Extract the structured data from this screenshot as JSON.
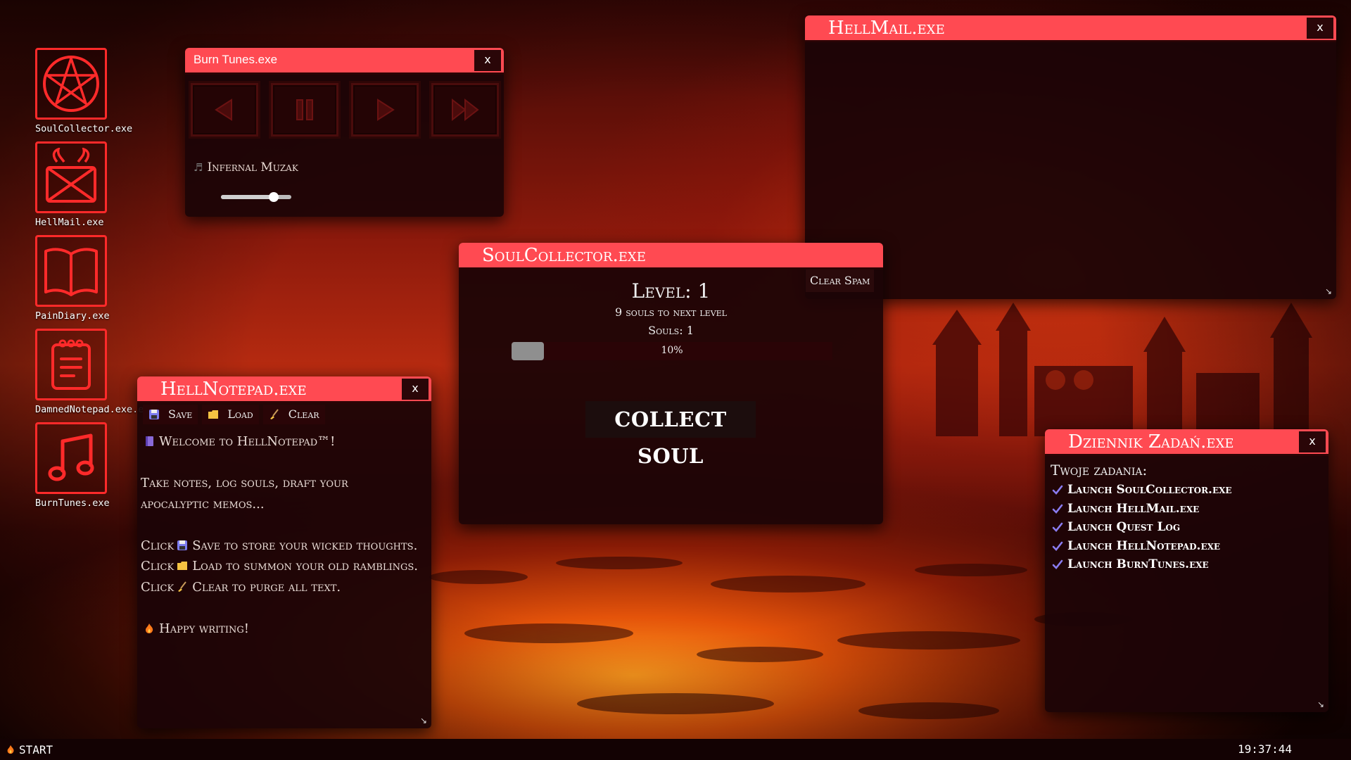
{
  "desktop": {
    "icons": [
      {
        "label": "SoulCollector.exe",
        "icon": "pentagram-icon"
      },
      {
        "label": "HellMail.exe",
        "icon": "horned-envelope-icon"
      },
      {
        "label": "PainDiary.exe",
        "icon": "open-book-icon"
      },
      {
        "label": "DamnedNotepad.exe.exe",
        "icon": "notepad-icon"
      },
      {
        "label": "BurnTunes.exe",
        "icon": "music-note-icon"
      }
    ]
  },
  "burn_tunes": {
    "title": "Burn Tunes.exe",
    "close": "x",
    "controls": [
      "rewind-icon",
      "pause-icon",
      "play-icon",
      "fast-forward-icon"
    ],
    "track_name": "Infernal Muzak",
    "volume": 0.75
  },
  "hellmail": {
    "title": "HellMail.exe",
    "close": "x",
    "clear_spam_label": "Clear Spam"
  },
  "soul_collector": {
    "title": "SoulCollector.exe",
    "level_text": "Level: 1",
    "to_next_text": "9 souls to next level",
    "souls_text": "Souls: 1",
    "progress_percent": 10,
    "progress_label": "10%",
    "collect_label": "COLLECT SOUL"
  },
  "notepad": {
    "title": "HellNotepad.exe",
    "close": "x",
    "toolbar": {
      "save": "Save",
      "load": "Load",
      "clear": "Clear"
    },
    "lines": {
      "welcome": "Welcome to HellNotepad™!",
      "intro": "Take notes, log souls, draft your apocalyptic memos...",
      "save_tip_a": "Click",
      "save_tip_b": "Save to store your wicked thoughts.",
      "load_tip_a": "Click",
      "load_tip_b": "Load to summon your old ramblings.",
      "clear_tip_a": "Click",
      "clear_tip_b": "Clear to purge all text.",
      "outro": "Happy writing!"
    }
  },
  "dziennik": {
    "title": "Dziennik Zadań.exe",
    "close": "x",
    "heading": "Twoje zadania:",
    "tasks": [
      "Launch SoulCollector.exe",
      "Launch HellMail.exe",
      "Launch Quest Log",
      "Launch HellNotepad.exe",
      "Launch BurnTunes.exe"
    ]
  },
  "taskbar": {
    "start_label": "START",
    "clock": "19:37:44"
  },
  "colors": {
    "titlebar": "#ff4a52",
    "icon_stroke": "#ff2a2a",
    "check": "#8a7cf0"
  }
}
